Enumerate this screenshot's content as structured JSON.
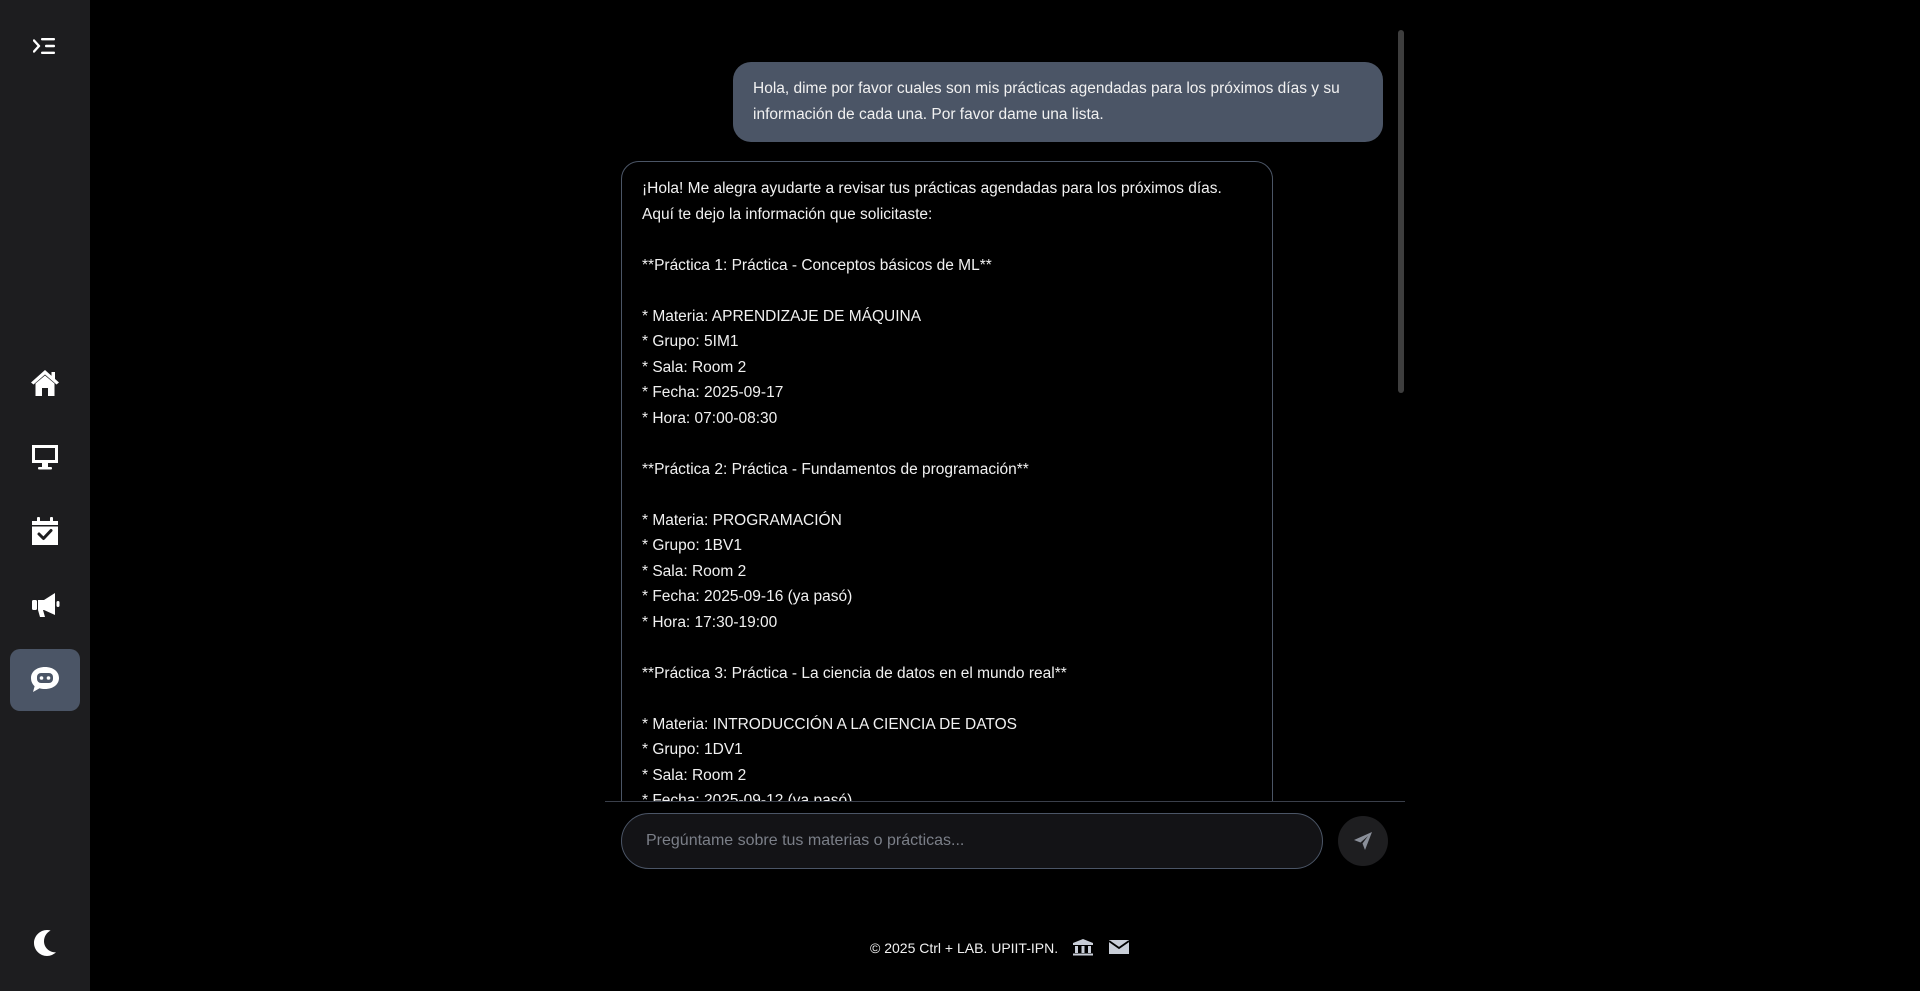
{
  "sidebar": {
    "items": [
      {
        "icon": "menu-toggle-icon"
      },
      {
        "icon": "home-icon"
      },
      {
        "icon": "monitor-icon"
      },
      {
        "icon": "calendar-check-icon"
      },
      {
        "icon": "megaphone-icon"
      },
      {
        "icon": "chatbot-icon",
        "active": true
      },
      {
        "icon": "moon-icon"
      }
    ]
  },
  "chat": {
    "user_message": "Hola, dime por favor cuales son mis prácticas agendadas para los próximos días y su información de cada una. Por favor dame una lista.",
    "bot_message": "¡Hola! Me alegra ayudarte a revisar tus prácticas agendadas para los próximos días. Aquí te dejo la información que solicitaste:\n\n**Práctica 1: Práctica - Conceptos básicos de ML**\n\n* Materia: APRENDIZAJE DE MÁQUINA\n* Grupo: 5IM1\n* Sala: Room 2\n* Fecha: 2025-09-17\n* Hora: 07:00-08:30\n\n**Práctica 2: Práctica - Fundamentos de programación**\n\n* Materia: PROGRAMACIÓN\n* Grupo: 1BV1\n* Sala: Room 2\n* Fecha: 2025-09-16 (ya pasó)\n* Hora: 17:30-19:00\n\n**Práctica 3: Práctica - La ciencia de datos en el mundo real**\n\n* Materia: INTRODUCCIÓN A LA CIENCIA DE DATOS\n* Grupo: 1DV1\n* Sala: Room 2\n* Fecha: 2025-09-12 (ya pasó)"
  },
  "input": {
    "placeholder": "Pregúntame sobre tus materias o prácticas..."
  },
  "footer": {
    "text": "© 2025 Ctrl + LAB. UPIIT-IPN."
  },
  "colors": {
    "sidebar_bg": "#1d1d1f",
    "accent": "#4b5566",
    "background": "#000000"
  }
}
